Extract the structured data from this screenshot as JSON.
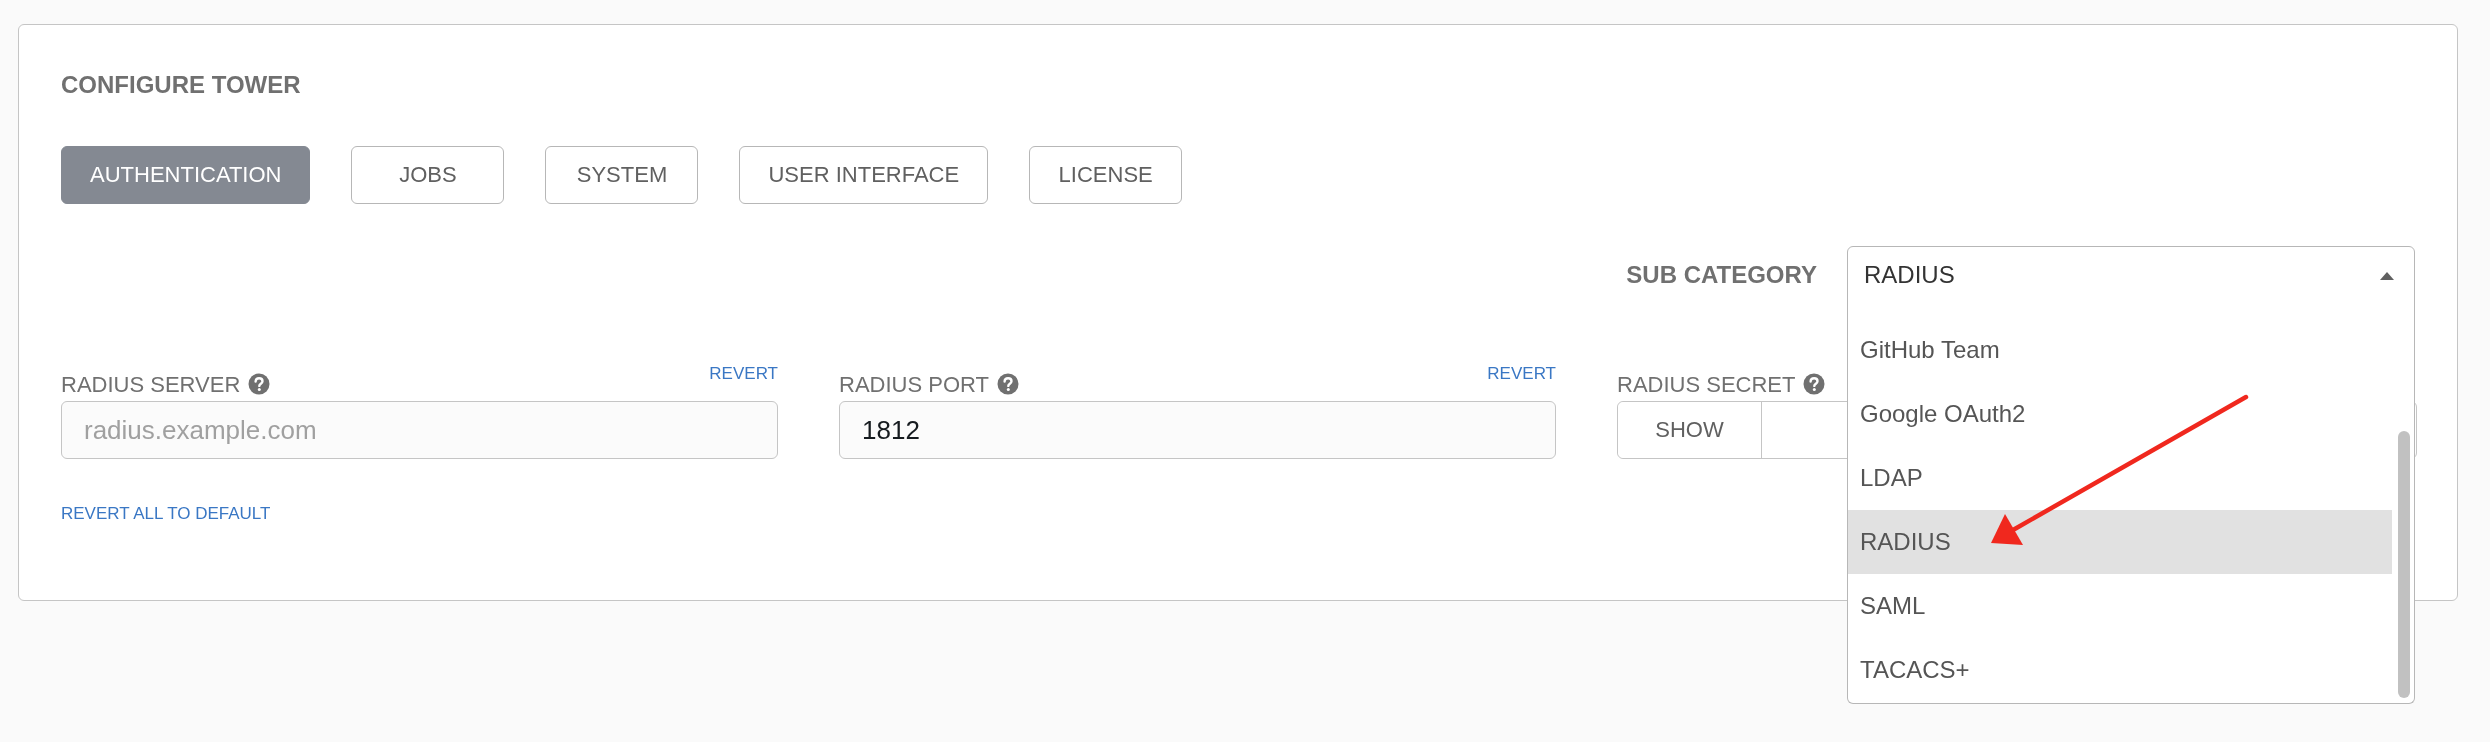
{
  "title": "CONFIGURE TOWER",
  "tabs": [
    {
      "label": "AUTHENTICATION",
      "selected": true
    },
    {
      "label": "JOBS",
      "selected": false
    },
    {
      "label": "SYSTEM",
      "selected": false
    },
    {
      "label": "USER INTERFACE",
      "selected": false
    },
    {
      "label": "LICENSE",
      "selected": false
    }
  ],
  "sub_category": {
    "label": "SUB CATEGORY",
    "value": "RADIUS",
    "expanded": true,
    "options": [
      {
        "label": "GitHub Team",
        "selected": false
      },
      {
        "label": "Google OAuth2",
        "selected": false
      },
      {
        "label": "LDAP",
        "selected": false
      },
      {
        "label": "RADIUS",
        "selected": true
      },
      {
        "label": "SAML",
        "selected": false
      },
      {
        "label": "TACACS+",
        "selected": false
      }
    ]
  },
  "fields": [
    {
      "kind": "text",
      "label": "RADIUS SERVER",
      "placeholder": "radius.example.com",
      "revert": "REVERT"
    },
    {
      "kind": "text",
      "label": "RADIUS PORT",
      "value": "1812",
      "revert": "REVERT"
    },
    {
      "kind": "secret",
      "label": "RADIUS SECRET",
      "button": "SHOW"
    }
  ],
  "revert_all": "REVERT ALL TO DEFAULT"
}
